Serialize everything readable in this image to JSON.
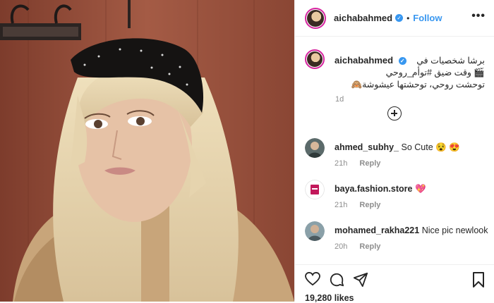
{
  "post": {
    "username": "aichabahmed",
    "follow_label": "Follow",
    "separator": "•",
    "caption_line1": "برشا شخصيات في",
    "caption_line2": "🎬 وقت ضيق #توأم_روحي",
    "caption_line3": "توحشت روحي، توحشتها عيشوشة🙈",
    "time_ago": "1d",
    "likes": "19,280 likes"
  },
  "comments": [
    {
      "user": "ahmed_subhy_",
      "text": "So Cute 😵 😍",
      "time": "21h",
      "reply": "Reply"
    },
    {
      "user": "baya.fashion.store",
      "text": "💖",
      "time": "21h",
      "reply": "Reply"
    },
    {
      "user": "mohamed_rakha221",
      "text": "Nice pic newlook",
      "time": "20h",
      "reply": "Reply"
    }
  ],
  "colors": {
    "accent": "#3897f0",
    "muted": "#8e8e8e",
    "text": "#262626",
    "border": "#efefef"
  },
  "icons": [
    "more-options-icon",
    "verified-badge-icon",
    "load-more-plus-icon",
    "heart-icon",
    "comment-icon",
    "share-icon",
    "bookmark-icon"
  ]
}
